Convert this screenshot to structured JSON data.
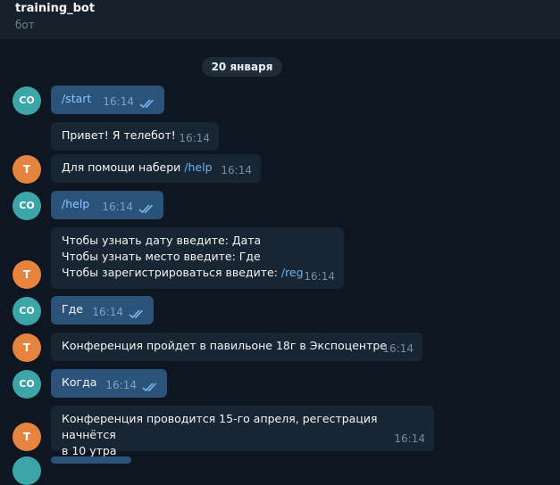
{
  "header": {
    "title": "training_bot",
    "subtitle": "бот"
  },
  "date_chip": "20 января",
  "avatars": {
    "user": "CO",
    "bot": "T"
  },
  "messages": [
    {
      "dir": "out",
      "text": "/start",
      "time": "16:14"
    },
    {
      "dir": "in",
      "text": "Привет! Я телебот!",
      "time": "16:14"
    },
    {
      "dir": "in",
      "text": "Для помощи набери ",
      "link": "/help",
      "time": "16:14"
    },
    {
      "dir": "out",
      "text": "/help",
      "time": "16:14"
    },
    {
      "dir": "in",
      "lines": [
        "Чтобы узнать дату введите: Дата",
        "Чтобы узнать место введите: Где",
        "Чтобы зарегистрироваться введите: "
      ],
      "link": "/reg",
      "time": "16:14"
    },
    {
      "dir": "out",
      "text": "Где",
      "time": "16:14"
    },
    {
      "dir": "in",
      "text": "Конференция пройдет в павильоне 18г в Экспоцентре",
      "time": "16:14"
    },
    {
      "dir": "out",
      "text": "Когда",
      "time": "16:14"
    },
    {
      "dir": "in",
      "lines": [
        "Конференция проводится 15-го апреля, регестрация начнётся",
        "в 10 утра"
      ],
      "time": "16:14"
    }
  ]
}
